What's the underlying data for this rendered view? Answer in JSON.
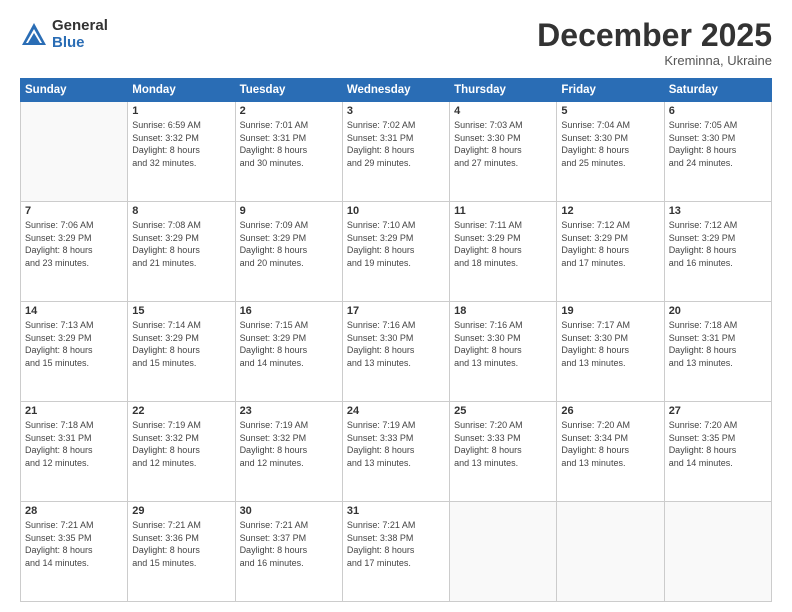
{
  "logo": {
    "general": "General",
    "blue": "Blue"
  },
  "header": {
    "month": "December 2025",
    "location": "Kreminna, Ukraine"
  },
  "days_of_week": [
    "Sunday",
    "Monday",
    "Tuesday",
    "Wednesday",
    "Thursday",
    "Friday",
    "Saturday"
  ],
  "weeks": [
    [
      {
        "day": "",
        "info": ""
      },
      {
        "day": "1",
        "info": "Sunrise: 6:59 AM\nSunset: 3:32 PM\nDaylight: 8 hours\nand 32 minutes."
      },
      {
        "day": "2",
        "info": "Sunrise: 7:01 AM\nSunset: 3:31 PM\nDaylight: 8 hours\nand 30 minutes."
      },
      {
        "day": "3",
        "info": "Sunrise: 7:02 AM\nSunset: 3:31 PM\nDaylight: 8 hours\nand 29 minutes."
      },
      {
        "day": "4",
        "info": "Sunrise: 7:03 AM\nSunset: 3:30 PM\nDaylight: 8 hours\nand 27 minutes."
      },
      {
        "day": "5",
        "info": "Sunrise: 7:04 AM\nSunset: 3:30 PM\nDaylight: 8 hours\nand 25 minutes."
      },
      {
        "day": "6",
        "info": "Sunrise: 7:05 AM\nSunset: 3:30 PM\nDaylight: 8 hours\nand 24 minutes."
      }
    ],
    [
      {
        "day": "7",
        "info": "Sunrise: 7:06 AM\nSunset: 3:29 PM\nDaylight: 8 hours\nand 23 minutes."
      },
      {
        "day": "8",
        "info": "Sunrise: 7:08 AM\nSunset: 3:29 PM\nDaylight: 8 hours\nand 21 minutes."
      },
      {
        "day": "9",
        "info": "Sunrise: 7:09 AM\nSunset: 3:29 PM\nDaylight: 8 hours\nand 20 minutes."
      },
      {
        "day": "10",
        "info": "Sunrise: 7:10 AM\nSunset: 3:29 PM\nDaylight: 8 hours\nand 19 minutes."
      },
      {
        "day": "11",
        "info": "Sunrise: 7:11 AM\nSunset: 3:29 PM\nDaylight: 8 hours\nand 18 minutes."
      },
      {
        "day": "12",
        "info": "Sunrise: 7:12 AM\nSunset: 3:29 PM\nDaylight: 8 hours\nand 17 minutes."
      },
      {
        "day": "13",
        "info": "Sunrise: 7:12 AM\nSunset: 3:29 PM\nDaylight: 8 hours\nand 16 minutes."
      }
    ],
    [
      {
        "day": "14",
        "info": "Sunrise: 7:13 AM\nSunset: 3:29 PM\nDaylight: 8 hours\nand 15 minutes."
      },
      {
        "day": "15",
        "info": "Sunrise: 7:14 AM\nSunset: 3:29 PM\nDaylight: 8 hours\nand 15 minutes."
      },
      {
        "day": "16",
        "info": "Sunrise: 7:15 AM\nSunset: 3:29 PM\nDaylight: 8 hours\nand 14 minutes."
      },
      {
        "day": "17",
        "info": "Sunrise: 7:16 AM\nSunset: 3:30 PM\nDaylight: 8 hours\nand 13 minutes."
      },
      {
        "day": "18",
        "info": "Sunrise: 7:16 AM\nSunset: 3:30 PM\nDaylight: 8 hours\nand 13 minutes."
      },
      {
        "day": "19",
        "info": "Sunrise: 7:17 AM\nSunset: 3:30 PM\nDaylight: 8 hours\nand 13 minutes."
      },
      {
        "day": "20",
        "info": "Sunrise: 7:18 AM\nSunset: 3:31 PM\nDaylight: 8 hours\nand 13 minutes."
      }
    ],
    [
      {
        "day": "21",
        "info": "Sunrise: 7:18 AM\nSunset: 3:31 PM\nDaylight: 8 hours\nand 12 minutes."
      },
      {
        "day": "22",
        "info": "Sunrise: 7:19 AM\nSunset: 3:32 PM\nDaylight: 8 hours\nand 12 minutes."
      },
      {
        "day": "23",
        "info": "Sunrise: 7:19 AM\nSunset: 3:32 PM\nDaylight: 8 hours\nand 12 minutes."
      },
      {
        "day": "24",
        "info": "Sunrise: 7:19 AM\nSunset: 3:33 PM\nDaylight: 8 hours\nand 13 minutes."
      },
      {
        "day": "25",
        "info": "Sunrise: 7:20 AM\nSunset: 3:33 PM\nDaylight: 8 hours\nand 13 minutes."
      },
      {
        "day": "26",
        "info": "Sunrise: 7:20 AM\nSunset: 3:34 PM\nDaylight: 8 hours\nand 13 minutes."
      },
      {
        "day": "27",
        "info": "Sunrise: 7:20 AM\nSunset: 3:35 PM\nDaylight: 8 hours\nand 14 minutes."
      }
    ],
    [
      {
        "day": "28",
        "info": "Sunrise: 7:21 AM\nSunset: 3:35 PM\nDaylight: 8 hours\nand 14 minutes."
      },
      {
        "day": "29",
        "info": "Sunrise: 7:21 AM\nSunset: 3:36 PM\nDaylight: 8 hours\nand 15 minutes."
      },
      {
        "day": "30",
        "info": "Sunrise: 7:21 AM\nSunset: 3:37 PM\nDaylight: 8 hours\nand 16 minutes."
      },
      {
        "day": "31",
        "info": "Sunrise: 7:21 AM\nSunset: 3:38 PM\nDaylight: 8 hours\nand 17 minutes."
      },
      {
        "day": "",
        "info": ""
      },
      {
        "day": "",
        "info": ""
      },
      {
        "day": "",
        "info": ""
      }
    ]
  ]
}
